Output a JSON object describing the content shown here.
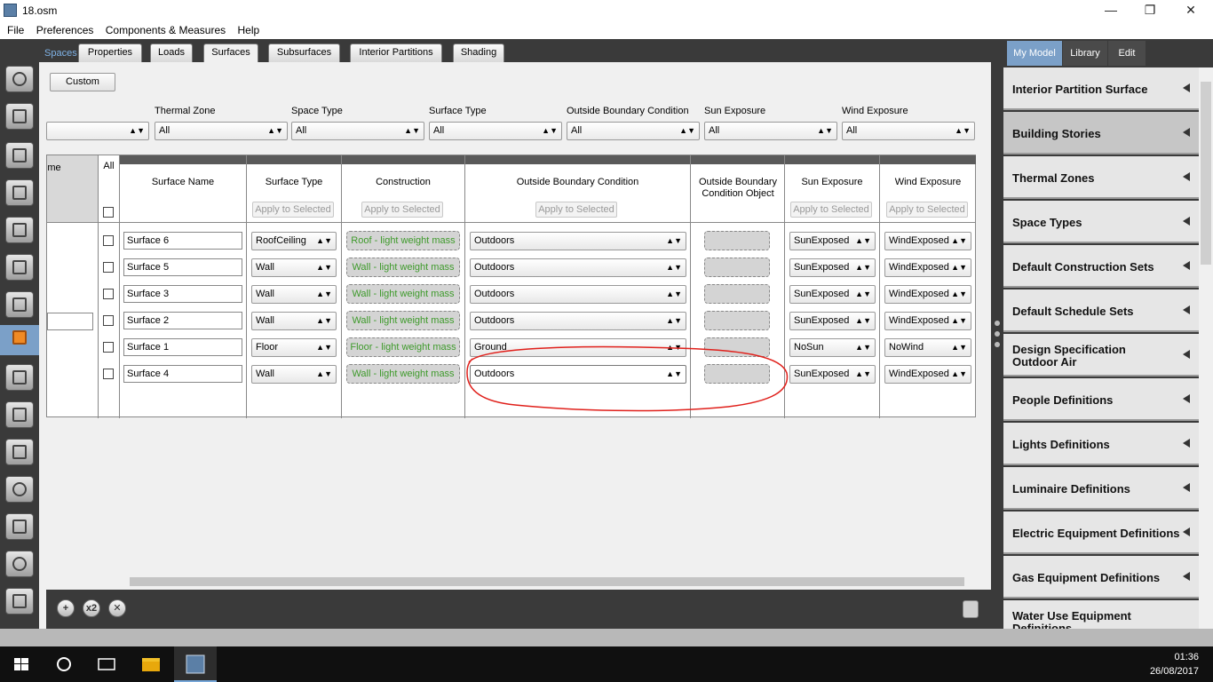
{
  "window": {
    "title": "18.osm",
    "min": "—",
    "max": "❐",
    "close": "✕"
  },
  "menu": [
    "File",
    "Preferences",
    "Components & Measures",
    "Help"
  ],
  "tabs": {
    "cropped": "Spaces",
    "items": [
      "Properties",
      "Loads",
      "Surfaces",
      "Subsurfaces",
      "Interior Partitions",
      "Shading"
    ],
    "active": "Surfaces"
  },
  "toolbar": {
    "custom_label": "Custom"
  },
  "filters": {
    "labels": [
      "Thermal Zone",
      "Space Type",
      "Surface Type",
      "Outside Boundary Condition",
      "Sun Exposure",
      "Wind Exposure"
    ],
    "values": [
      "All",
      "All",
      "All",
      "All",
      "All",
      "All"
    ]
  },
  "grid": {
    "cropped_header": "me",
    "all_label": "All",
    "headers": {
      "surface_name": "Surface Name",
      "surface_type": "Surface Type",
      "construction": "Construction",
      "obc": "Outside Boundary Condition",
      "obc_object": "Outside Boundary Condition Object",
      "sun": "Sun Exposure",
      "wind": "Wind Exposure"
    },
    "apply_label": "Apply to Selected",
    "rows": [
      {
        "name": "Surface 6",
        "type": "RoofCeiling",
        "construction": "Roof -  light weight mass",
        "obc": "Outdoors",
        "sun": "SunExposed",
        "wind": "WindExposed"
      },
      {
        "name": "Surface 5",
        "type": "Wall",
        "construction": "Wall - light weight mass",
        "obc": "Outdoors",
        "sun": "SunExposed",
        "wind": "WindExposed"
      },
      {
        "name": "Surface 3",
        "type": "Wall",
        "construction": "Wall - light weight mass",
        "obc": "Outdoors",
        "sun": "SunExposed",
        "wind": "WindExposed"
      },
      {
        "name": "Surface 2",
        "type": "Wall",
        "construction": "Wall - light weight mass",
        "obc": "Outdoors",
        "sun": "SunExposed",
        "wind": "WindExposed"
      },
      {
        "name": "Surface 1",
        "type": "Floor",
        "construction": "Floor -  light weight mass",
        "obc": "Ground",
        "sun": "NoSun",
        "wind": "NoWind"
      },
      {
        "name": "Surface 4",
        "type": "Wall",
        "construction": "Wall - light weight mass",
        "obc": "Outdoors",
        "sun": "SunExposed",
        "wind": "WindExposed"
      }
    ]
  },
  "bottom": {
    "add": "+",
    "copy": "x2",
    "remove": "✕"
  },
  "right_panel": {
    "tabs": [
      "My Model",
      "Library",
      "Edit"
    ],
    "items": [
      "Interior Partition Surface",
      "Building Stories",
      "Thermal Zones",
      "Space Types",
      "Default Construction Sets",
      "Default Schedule Sets",
      "Design Specification Outdoor Air",
      "People Definitions",
      "Lights Definitions",
      "Luminaire Definitions",
      "Electric Equipment Definitions",
      "Gas Equipment Definitions",
      "Water Use Equipment Definitions"
    ]
  },
  "taskbar": {
    "time": "01:36",
    "date": "26/08/2017"
  },
  "colors": {
    "rail": "#3a3a3a",
    "accent": "#7ba0c8",
    "construction_text": "#3e9a2b",
    "annotation": "#e0201b"
  }
}
